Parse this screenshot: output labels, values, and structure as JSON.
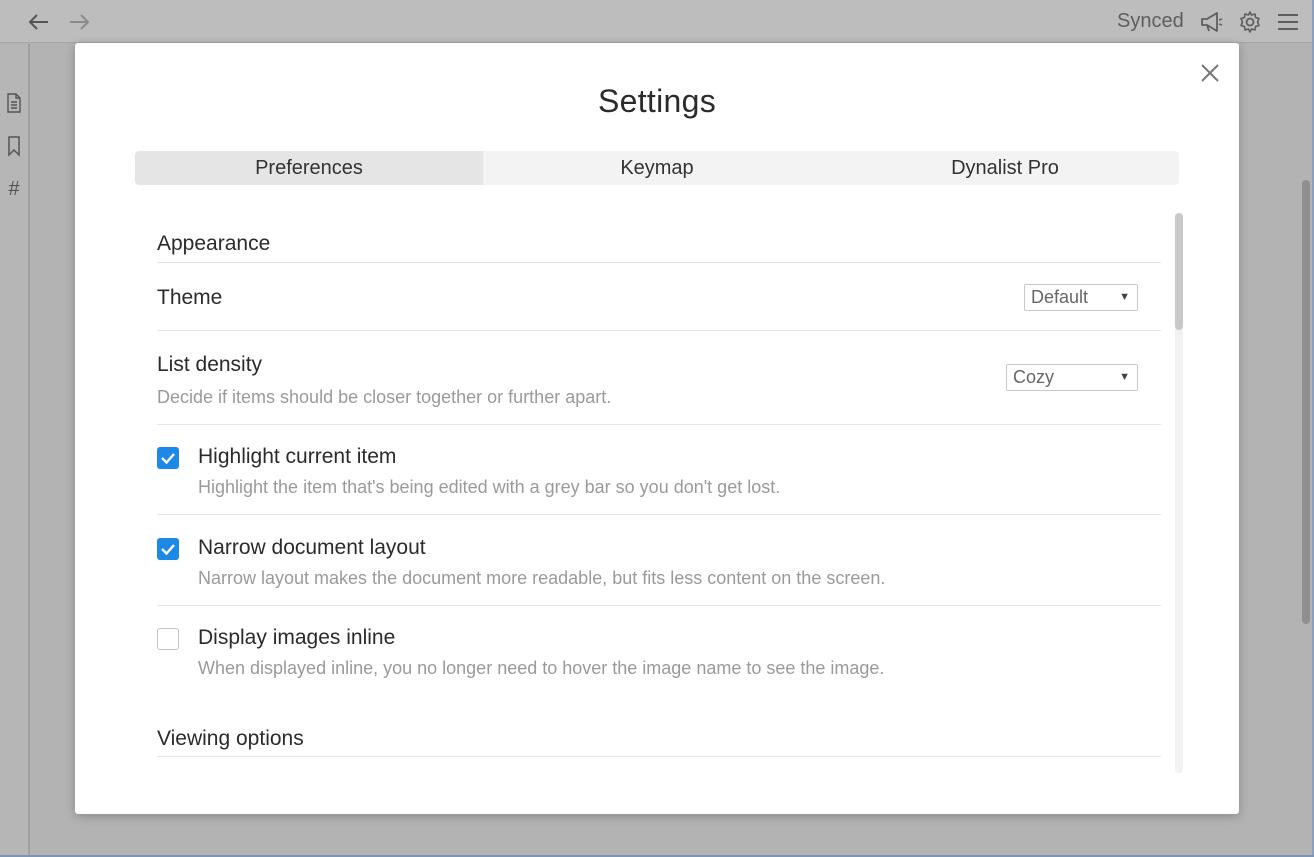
{
  "app": {
    "status": "Synced",
    "icons": [
      "back-arrow-icon",
      "forward-arrow-icon",
      "megaphone-icon",
      "gear-icon",
      "hamburger-menu-icon"
    ],
    "sidebar_icons": [
      "document-icon",
      "bookmark-icon",
      "hashtag-icon"
    ],
    "hashtag_glyph": "#"
  },
  "modal": {
    "title": "Settings",
    "tabs": [
      {
        "label": "Preferences",
        "active": true
      },
      {
        "label": "Keymap",
        "active": false
      },
      {
        "label": "Dynalist Pro",
        "active": false
      }
    ],
    "sections": {
      "appearance": {
        "heading": "Appearance",
        "theme": {
          "label": "Theme",
          "value": "Default"
        },
        "list_density": {
          "label": "List density",
          "description": "Decide if items should be closer together or further apart.",
          "value": "Cozy"
        },
        "highlight_current_item": {
          "label": "Highlight current item",
          "description": "Highlight the item that's being edited with a grey bar so you don't get lost.",
          "checked": true
        },
        "narrow_layout": {
          "label": "Narrow document layout",
          "description": "Narrow layout makes the document more readable, but fits less content on the screen.",
          "checked": true
        },
        "display_images_inline": {
          "label": "Display images inline",
          "description": "When displayed inline, you no longer need to hover the image name to see the image.",
          "checked": false
        }
      },
      "viewing": {
        "heading": "Viewing options"
      }
    },
    "select_arrow": "▼"
  },
  "colors": {
    "accent": "#1e88e5",
    "overlay": "#b3b3b3"
  }
}
